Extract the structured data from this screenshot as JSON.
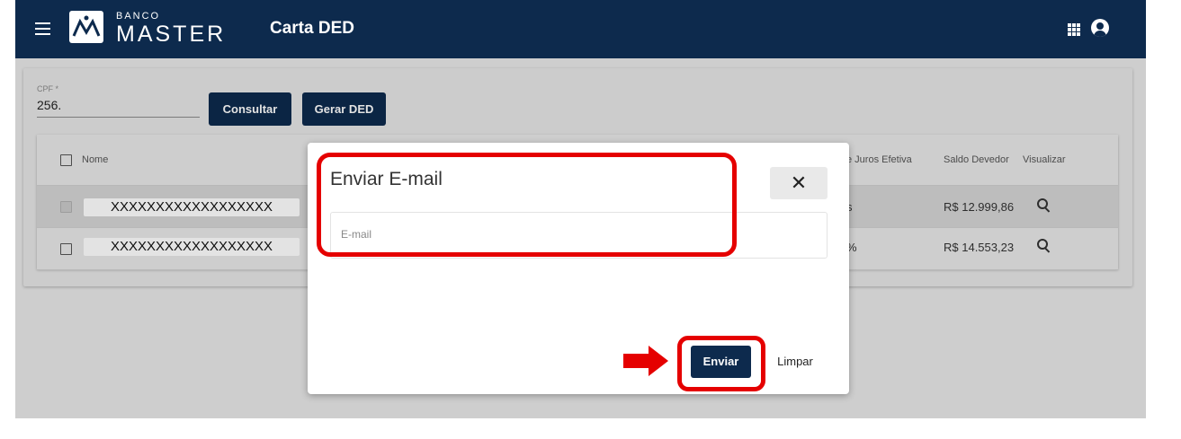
{
  "appbar": {
    "brand_small": "BANCO",
    "brand_big": "MASTER",
    "title": "Carta DED",
    "icons": [
      "menu-icon",
      "apps-grid-icon",
      "account-circle-icon"
    ]
  },
  "form": {
    "cpf_label": "CPF *",
    "cpf_value": "256.",
    "consultar_label": "Consultar",
    "gerar_label": "Gerar DED"
  },
  "table": {
    "headers": {
      "nome": "Nome",
      "juros": "e Juros Efetiva",
      "saldo": "Saldo Devedor",
      "visualizar": "Visualizar"
    },
    "rows": [
      {
        "nome": "XXXXXXXXXXXXXXXXXX",
        "juros": "s",
        "saldo": "R$ 12.999,86",
        "checked": true
      },
      {
        "nome": "XXXXXXXXXXXXXXXXXX",
        "juros": "%",
        "saldo": "R$ 14.553,23",
        "checked": false
      }
    ]
  },
  "dialog": {
    "title": "Enviar E-mail",
    "close_label": "✕",
    "email_placeholder": "E-mail",
    "email_value": "",
    "enviar_label": "Enviar",
    "limpar_label": "Limpar"
  },
  "annotations": {
    "highlight_color": "#e50000"
  },
  "colors": {
    "primary": "#0d2a4d",
    "background": "#e8e8e8"
  }
}
